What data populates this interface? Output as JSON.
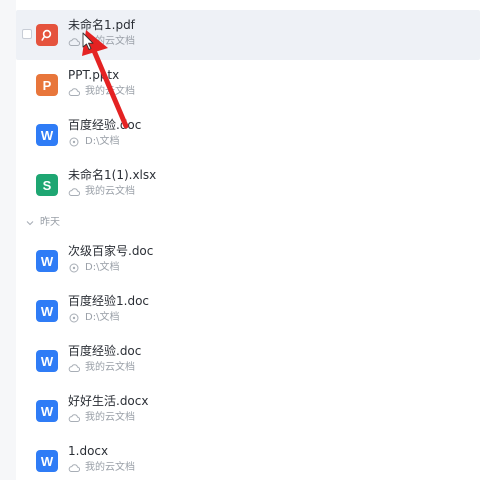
{
  "colors": {
    "pdf": "#e5533d",
    "ppt": "#e8763b",
    "word": "#2f7cf6",
    "excel": "#1ea672",
    "arrow": "#e42222",
    "selected_row": "#eef1f6"
  },
  "files_top": [
    {
      "name": "未命名1.pdf",
      "location": "我的云文档",
      "type": "pdf",
      "loc_icon": "cloud-icon"
    },
    {
      "name": "PPT.pptx",
      "location": "我的云文档",
      "type": "ppt",
      "loc_icon": "cloud-icon"
    },
    {
      "name": "百度经验.doc",
      "location": "D:\\文档",
      "type": "word",
      "loc_icon": "disk-icon"
    },
    {
      "name": "未命名1(1).xlsx",
      "location": "我的云文档",
      "type": "excel",
      "loc_icon": "cloud-icon"
    }
  ],
  "group_yesterday": {
    "label": "昨天"
  },
  "files_yesterday": [
    {
      "name": "次级百家号.doc",
      "location": "D:\\文档",
      "type": "word",
      "loc_icon": "disk-icon"
    },
    {
      "name": "百度经验1.doc",
      "location": "D:\\文档",
      "type": "word",
      "loc_icon": "disk-icon"
    },
    {
      "name": "百度经验.doc",
      "location": "我的云文档",
      "type": "word",
      "loc_icon": "cloud-icon"
    },
    {
      "name": "好好生活.docx",
      "location": "我的云文档",
      "type": "word",
      "loc_icon": "cloud-icon"
    },
    {
      "name": "1.docx",
      "location": "我的云文档",
      "type": "word",
      "loc_icon": "cloud-icon"
    }
  ]
}
